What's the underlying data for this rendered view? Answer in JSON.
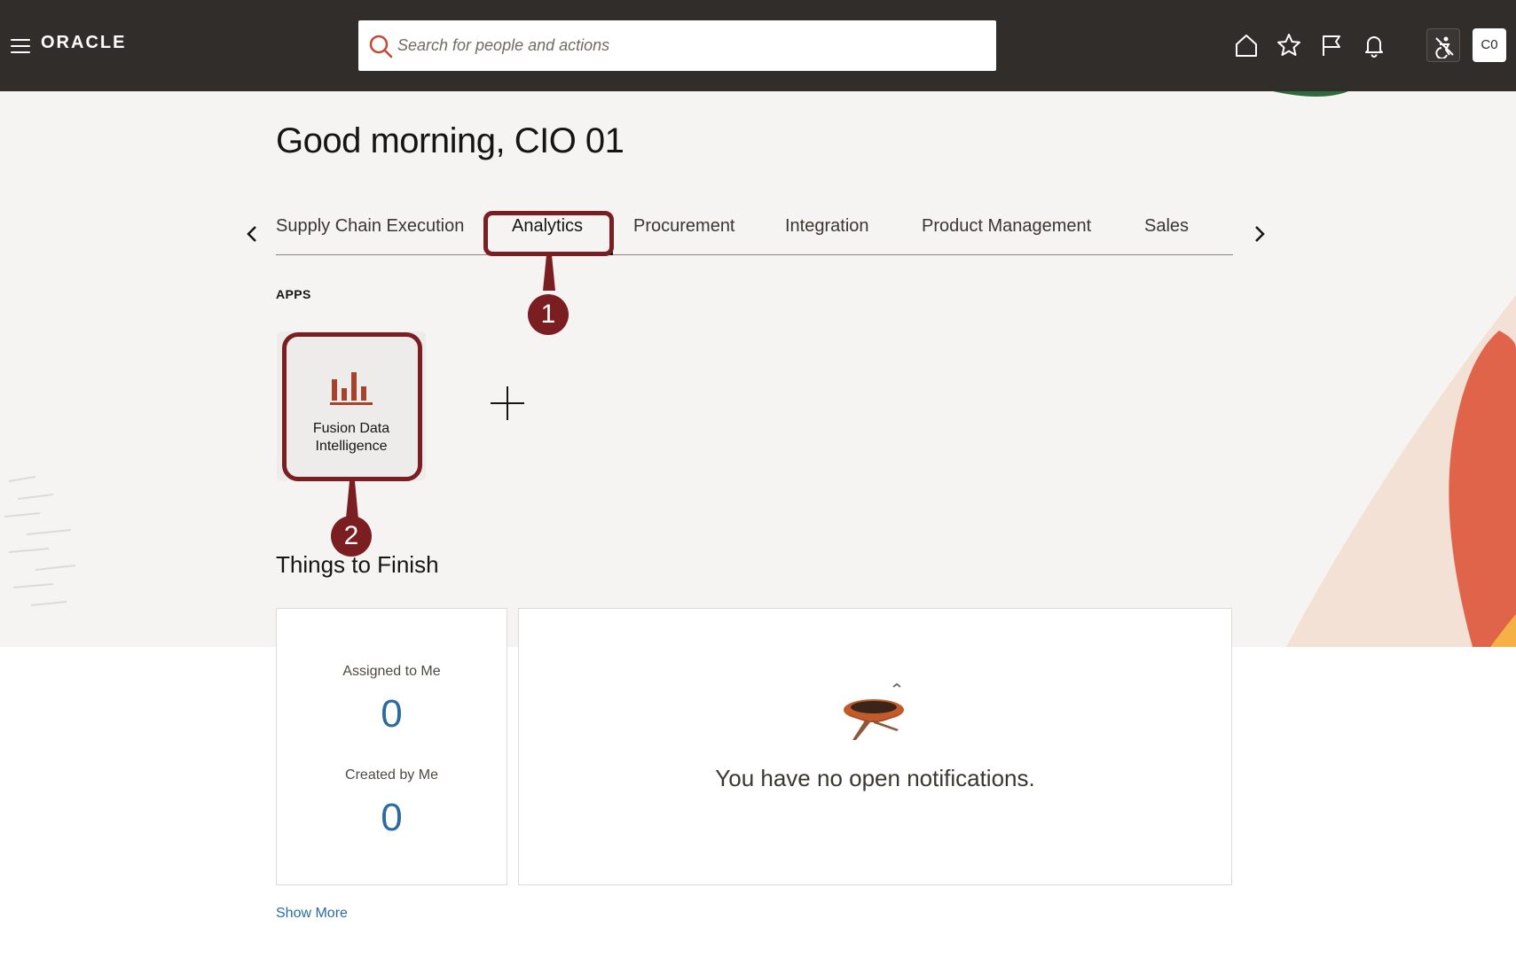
{
  "header": {
    "brand": "ORACLE",
    "search_placeholder": "Search for people and actions",
    "avatar_initials": "C0",
    "icons": [
      "home-icon",
      "favorites-star-icon",
      "flag-icon",
      "notifications-bell-icon",
      "accessibility-icon"
    ]
  },
  "greeting": "Good morning, CIO 01",
  "tabs": [
    {
      "label": "Supply Chain Execution"
    },
    {
      "label": "Analytics",
      "active": true
    },
    {
      "label": "Procurement"
    },
    {
      "label": "Integration"
    },
    {
      "label": "Product Management"
    },
    {
      "label": "Sales"
    }
  ],
  "apps": {
    "section_label": "APPS",
    "items": [
      {
        "label": "Fusion Data Intelligence",
        "icon": "bar-chart-icon"
      }
    ]
  },
  "callouts": [
    "1",
    "2"
  ],
  "things_to_finish": {
    "title": "Things to Finish",
    "assigned_label": "Assigned to Me",
    "assigned_value": "0",
    "created_label": "Created by Me",
    "created_value": "0",
    "empty_message": "You have no open notifications.",
    "show_more": "Show More"
  },
  "colors": {
    "header_bg": "#312d2a",
    "callout": "#7b1e22",
    "link": "#2a6ca1",
    "app_icon": "#a5432c"
  }
}
